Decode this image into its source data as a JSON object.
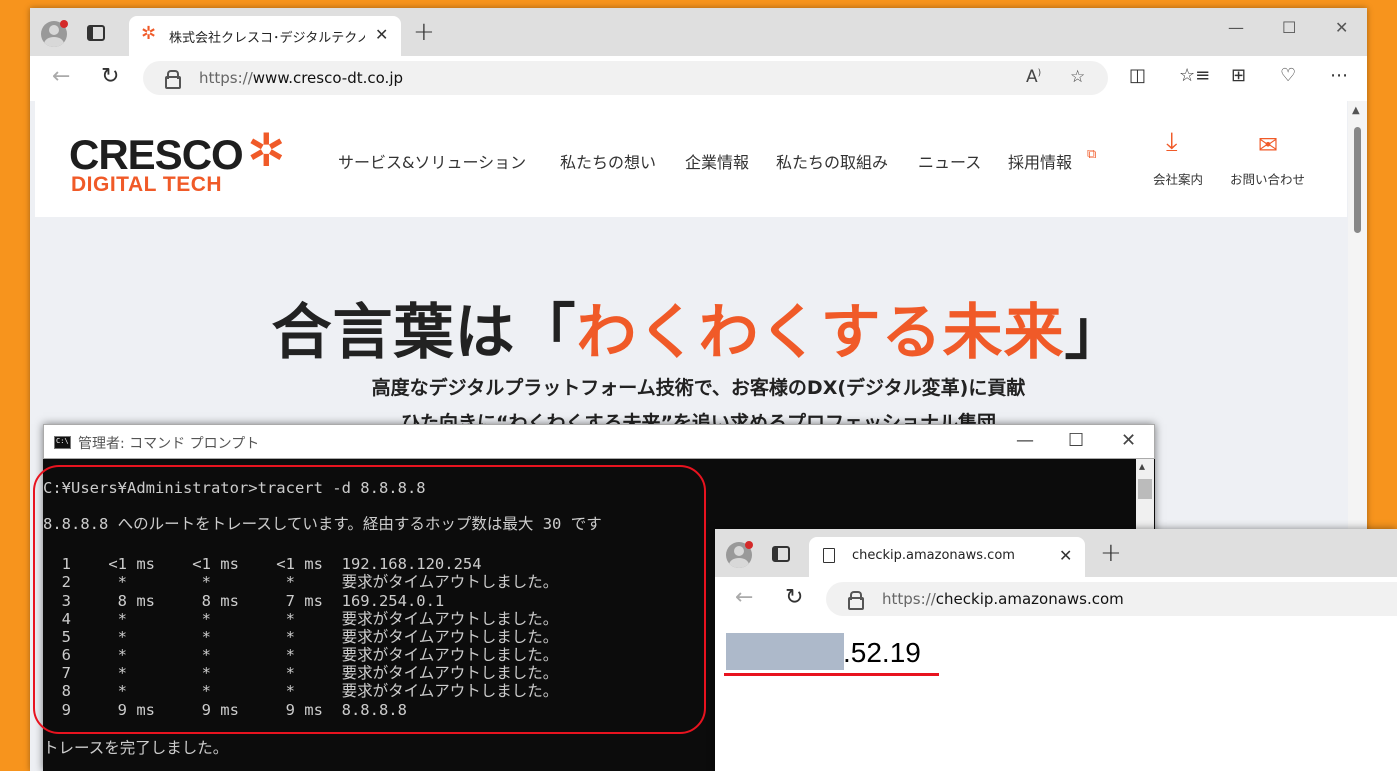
{
  "browser_main": {
    "tab_title": "株式会社クレスコ･デジタルテクノロジー",
    "url_protocol": "https://",
    "url_host": "www.cresco-dt.co.jp",
    "icons": [
      "profile-icon",
      "tab-actions-icon",
      "back-icon",
      "refresh-icon",
      "lock-icon",
      "read-aloud-icon",
      "favorite-star-icon",
      "split-screen-icon",
      "favorites-icon",
      "collections-icon",
      "browser-essentials-icon",
      "more-icon"
    ]
  },
  "site": {
    "logo_main": "CRESCO",
    "logo_sub": "DIGITAL TECH",
    "nav": [
      "サービス&ソリューション",
      "私たちの想い",
      "企業情報",
      "私たちの取組み",
      "ニュース",
      "採用情報"
    ],
    "header_actions": [
      {
        "label": "会社案内",
        "icon": "download-icon"
      },
      {
        "label": "お問い合わせ",
        "icon": "mail-icon"
      }
    ],
    "headline_prefix": "合言葉は「",
    "headline_highlight": "わくわくする未来",
    "headline_suffix": "」",
    "subline1": "高度なデジタルプラットフォーム技術で、お客様のDX(デジタル変革)に貢献",
    "subline2": "ひた向きに“わくわくする未来”を追い求めるプロフェッショナル集団",
    "accent_color": "#f05a28"
  },
  "cmd": {
    "title": "管理者: コマンド プロンプト",
    "lines": [
      "C:¥Users¥Administrator>tracert -d 8.8.8.8",
      "",
      "8.8.8.8 へのルートをトレースしています。経由するホップ数は最大 30 です",
      "",
      "  1    <1 ms    <1 ms    <1 ms  192.168.120.254",
      "  2     *        *        *     要求がタイムアウトしました。",
      "  3     8 ms     8 ms     7 ms  169.254.0.1",
      "  4     *        *        *     要求がタイムアウトしました。",
      "  5     *        *        *     要求がタイムアウトしました。",
      "  6     *        *        *     要求がタイムアウトしました。",
      "  7     *        *        *     要求がタイムアウトしました。",
      "  8     *        *        *     要求がタイムアウトしました。",
      "  9     9 ms     9 ms     9 ms  8.8.8.8",
      "",
      "トレースを完了しました。"
    ]
  },
  "browser_second": {
    "tab_title": "checkip.amazonaws.com",
    "url_protocol": "https://",
    "url_host": "checkip.amazonaws.com",
    "ip_visible_suffix": ".52.19",
    "highlight_color": "#e8131f"
  }
}
